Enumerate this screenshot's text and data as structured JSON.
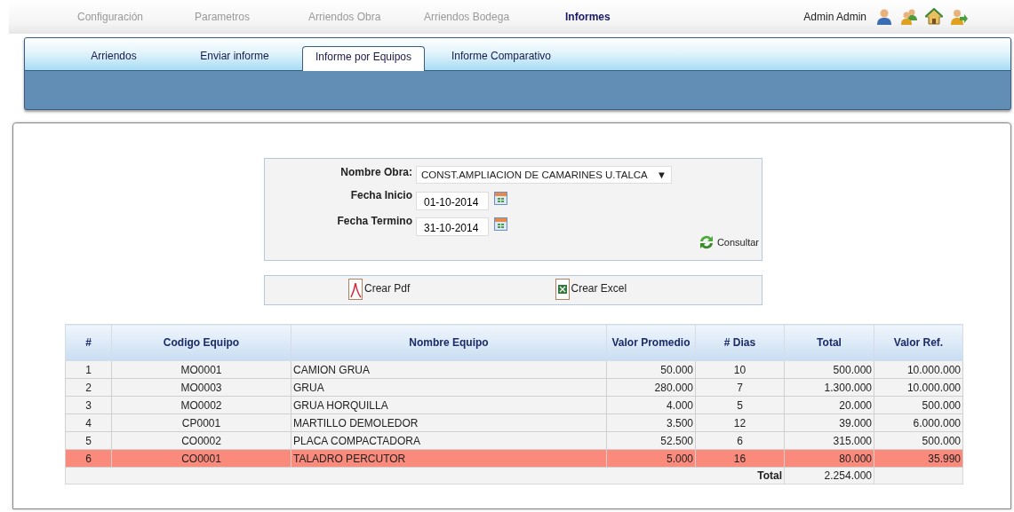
{
  "top_menu": [
    {
      "label": "Configuración",
      "selected": false
    },
    {
      "label": "Parametros",
      "selected": false
    },
    {
      "label": "Arriendos Obra",
      "selected": false
    },
    {
      "label": "Arriendos Bodega",
      "selected": false
    },
    {
      "label": "Informes",
      "selected": true
    }
  ],
  "user": {
    "name": "Admin Admin"
  },
  "tabs": [
    {
      "label": "Arriendos",
      "selected": false
    },
    {
      "label": "Enviar informe",
      "selected": false
    },
    {
      "label": "Informe por Equipos",
      "selected": true
    },
    {
      "label": "Informe Comparativo",
      "selected": false
    }
  ],
  "form": {
    "fields": [
      {
        "kind": "select",
        "label": "Nombre Obra:",
        "value": "CONST.AMPLIACION DE CAMARINES U.TALCA",
        "caret": "▼"
      },
      {
        "kind": "date",
        "label": "Fecha Inicio",
        "value": "01-10-2014"
      },
      {
        "kind": "date",
        "label": "Fecha Termino",
        "value": "31-10-2014"
      }
    ],
    "submit": "Consultar"
  },
  "exports": [
    {
      "kind": "pdf",
      "label": "Crear Pdf"
    },
    {
      "kind": "excel",
      "label": "Crear Excel"
    }
  ],
  "table": {
    "columns": [
      "#",
      "Codigo Equipo",
      "Nombre Equipo",
      "Valor Promedio",
      "# Dias",
      "Total",
      "Valor Ref."
    ],
    "rows": [
      {
        "cells": [
          "1",
          "MO0001",
          "CAMION GRUA",
          "50.000",
          "10",
          "500.000",
          "10.000.000"
        ],
        "highlighted": false
      },
      {
        "cells": [
          "2",
          "MO0003",
          "GRUA",
          "280.000",
          "7",
          "1.300.000",
          "10.000.000"
        ],
        "highlighted": false
      },
      {
        "cells": [
          "3",
          "MO0002",
          "GRUA HORQUILLA",
          "4.000",
          "5",
          "20.000",
          "500.000"
        ],
        "highlighted": false
      },
      {
        "cells": [
          "4",
          "CP0001",
          "MARTILLO DEMOLEDOR",
          "3.500",
          "12",
          "39.000",
          "6.000.000"
        ],
        "highlighted": false
      },
      {
        "cells": [
          "5",
          "CO0002",
          "PLACA COMPACTADORA",
          "52.500",
          "6",
          "315.000",
          "500.000"
        ],
        "highlighted": false
      },
      {
        "cells": [
          "6",
          "CO0001",
          "TALADRO PERCUTOR",
          "5.000",
          "16",
          "80.000",
          "35.990"
        ],
        "highlighted": true
      }
    ],
    "footer": {
      "label": "Total",
      "value": "2.254.000"
    }
  }
}
